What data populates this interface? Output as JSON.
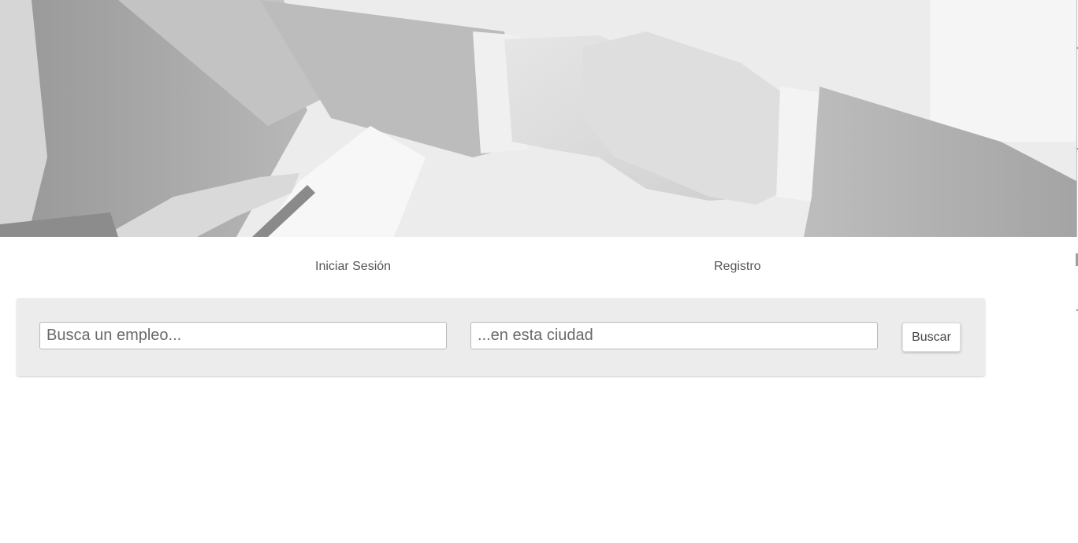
{
  "hero": {
    "image": "handshake-photo"
  },
  "nav": {
    "login_label": "Iniciar Sesión",
    "register_label": "Registro"
  },
  "search": {
    "job_placeholder": "Busca un empleo...",
    "job_value": "",
    "city_placeholder": "...en esta ciudad",
    "city_value": "",
    "button_label": "Buscar"
  },
  "colors": {
    "panel_background": "#ececec",
    "link_text": "#555555",
    "page_background": "#ffffff"
  }
}
